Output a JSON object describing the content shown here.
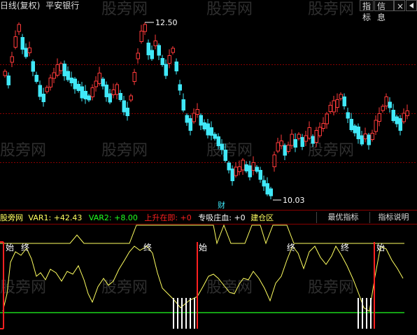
{
  "header": {
    "period_label": "日线(复权)",
    "stock_name": "平安银行",
    "btn_index": "指标",
    "btn_info": "信息",
    "btn_close": "×"
  },
  "watermark": "股旁网",
  "price_chart": {
    "high_label": "12.50",
    "low_label": "10.03",
    "finance_marker": "财",
    "price_range": [
      9.9,
      12.62
    ]
  },
  "indicator": {
    "name": "股旁网",
    "var1_label": "VAR1: ",
    "var1_value": "+42.43",
    "var2_label": "VAR2: ",
    "var2_value": "+8.00",
    "rise_label": "上升在即: ",
    "rise_value": "+0",
    "absorb_label": "专吸庄血: ",
    "absorb_value": "+0",
    "zone_label": "建仓区",
    "tab_best": "最优指标",
    "tab_help": "指标说明",
    "signal_start": "始",
    "signal_end": "终"
  },
  "colors": {
    "up": "#ff3a3a",
    "down": "#40e8f8",
    "yellow": "#ffff60",
    "green": "#20ff20",
    "grid": "#8a0000",
    "red_line": "#ff2020",
    "white": "#ffffff"
  }
}
